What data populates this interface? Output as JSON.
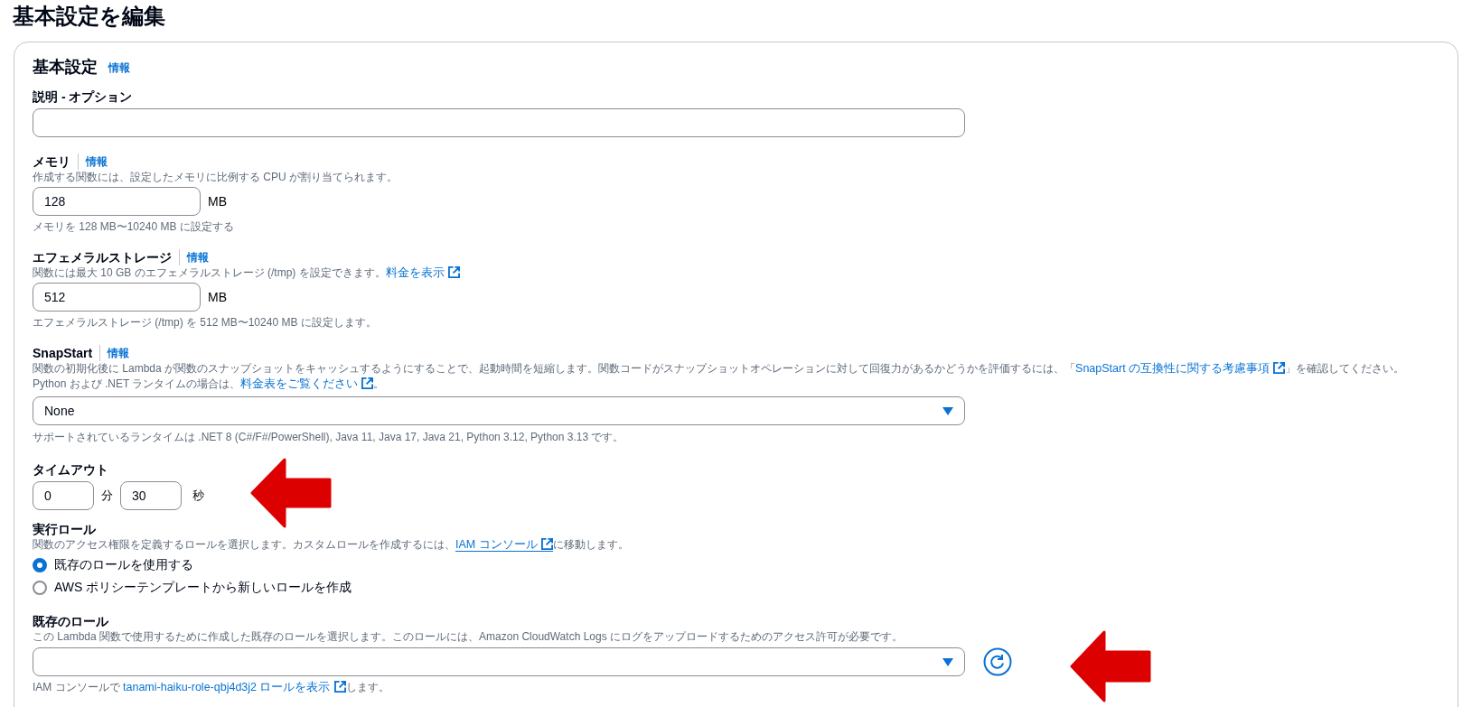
{
  "page_title": "基本設定を編集",
  "section": {
    "title": "基本設定",
    "info": "情報"
  },
  "fields": [
    {
      "kind": "text",
      "label": "説明 - オプション"
    },
    {
      "kind": "number_unit",
      "label": "メモリ",
      "info": "情報",
      "description": [
        {
          "kind": "text",
          "text": "作成する関数には、設定したメモリに比例する CPU が割り当てられます。"
        }
      ],
      "value": "128",
      "unit": "MB",
      "hint": "メモリを 128 MB〜10240 MB に設定する"
    },
    {
      "kind": "number_unit",
      "label": "エフェメラルストレージ",
      "info": "情報",
      "description": [
        {
          "kind": "text",
          "text": "関数には最大 10 GB のエフェメラルストレージ (/tmp) を設定できます。"
        },
        {
          "kind": "link",
          "text": "料金を表示",
          "underlined": false
        }
      ],
      "value": "512",
      "unit": "MB",
      "hint": "エフェメラルストレージ (/tmp) を 512 MB〜10240 MB に設定します。"
    },
    {
      "kind": "select",
      "label": "SnapStart",
      "info": "情報",
      "description": [
        {
          "kind": "text",
          "text": "関数の初期化後に Lambda が関数のスナップショットをキャッシュするようにすることで、起動時間を短縮します。関数コードがスナップショットオペレーションに対して回復力があるかどうかを評価するには、「"
        },
        {
          "kind": "link",
          "text": "SnapStart の互換性に関する考慮事項",
          "underlined": false
        },
        {
          "kind": "text",
          "text": "」を確認してください。 Python および .NET ランタイムの場合は、"
        },
        {
          "kind": "link",
          "text": "料金表をご覧ください",
          "underlined": false
        },
        {
          "kind": "text",
          "text": "。"
        }
      ],
      "value": "None",
      "hint": "サポートされているランタイムは .NET 8 (C#/F#/PowerShell), Java 11, Java 17, Java 21, Python 3.12, Python 3.13 です。"
    },
    {
      "kind": "timeout",
      "label": "タイムアウト",
      "minutes": "0",
      "minutes_unit": "分",
      "seconds": "30",
      "seconds_unit": "秒"
    },
    {
      "kind": "radio",
      "label": "実行ロール",
      "description": [
        {
          "kind": "text",
          "text": "関数のアクセス権限を定義するロールを選択します。カスタムロールを作成するには、"
        },
        {
          "kind": "link",
          "text": "IAM コンソール",
          "underlined": true
        },
        {
          "kind": "text",
          "text": "に移動します。"
        }
      ],
      "options": [
        {
          "label": "既存のロールを使用する",
          "selected": true
        },
        {
          "label": "AWS ポリシーテンプレートから新しいロールを作成",
          "selected": false
        }
      ]
    },
    {
      "kind": "select_refresh",
      "label": "既存のロール",
      "description": [
        {
          "kind": "text",
          "text": "この Lambda 関数で使用するために作成した既存のロールを選択します。このロールには、Amazon CloudWatch Logs にログをアップロードするためのアクセス許可が必要です。"
        }
      ],
      "hint_parts": [
        {
          "kind": "text",
          "text": "IAM コンソールで "
        },
        {
          "kind": "link",
          "text": "tanami-haiku-role-qbj4d3j2 ロールを表示",
          "underlined": false
        },
        {
          "kind": "text",
          "text": "します。"
        }
      ]
    }
  ]
}
